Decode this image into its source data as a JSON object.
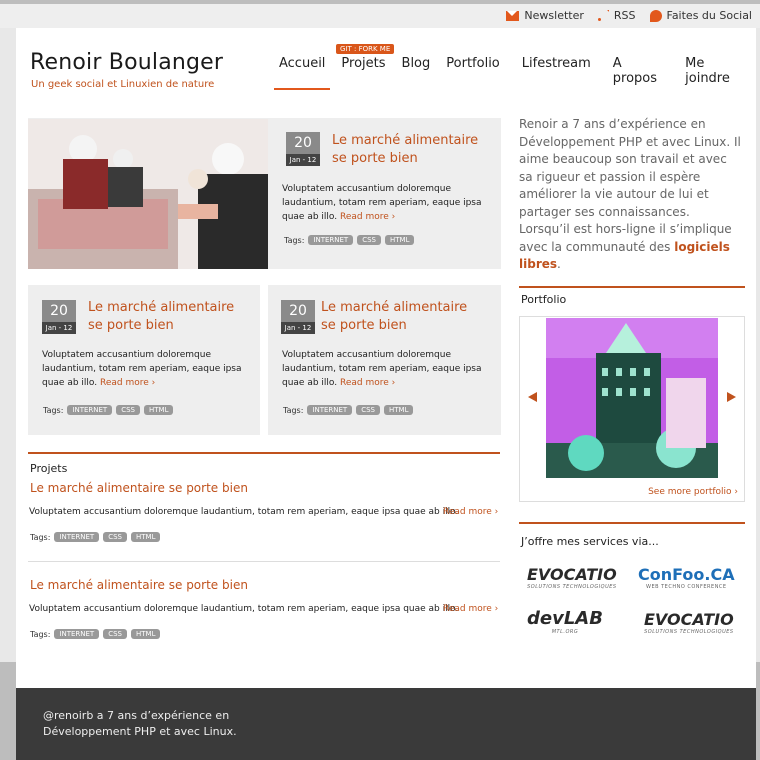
{
  "topbar": {
    "newsletter": "Newsletter",
    "rss": "RSS",
    "social": "Faites du Social"
  },
  "header": {
    "logo": "Renoir Boulanger",
    "tagline": "Un geek social et Linuxien de nature",
    "git_badge": "GIT : FORK ME",
    "nav": [
      "Accueil",
      "Projets",
      "Blog",
      "Portfolio",
      "Lifestream",
      "A propos",
      "Me joindre"
    ]
  },
  "featured": {
    "day": "20",
    "month": "Jan - 12",
    "title": "Le marché alimentaire se porte bien",
    "excerpt": "Voluptatem accusantium doloremque laudantium, totam rem aperiam, eaque ipsa quae ab illo.",
    "more": "Read more ›",
    "tags_label": "Tags:",
    "tags": [
      "INTERNET",
      "CSS",
      "HTML"
    ]
  },
  "cards": [
    {
      "day": "20",
      "month": "Jan - 12",
      "title": "Le marché alimentaire se porte bien",
      "excerpt": "Voluptatem accusantium doloremque laudantium, totam rem aperiam, eaque ipsa quae ab illo.",
      "more": "Read more ›",
      "tags_label": "Tags:",
      "tags": [
        "INTERNET",
        "CSS",
        "HTML"
      ]
    },
    {
      "day": "20",
      "month": "Jan - 12",
      "title": "Le marché alimentaire se porte bien",
      "excerpt": "Voluptatem accusantium doloremque laudantium, totam rem aperiam, eaque ipsa quae ab illo.",
      "more": "Read more ›",
      "tags_label": "Tags:",
      "tags": [
        "INTERNET",
        "CSS",
        "HTML"
      ]
    }
  ],
  "projects": {
    "heading": "Projets",
    "items": [
      {
        "title": "Le marché alimentaire se porte bien",
        "excerpt": "Voluptatem accusantium doloremque laudantium, totam rem aperiam, eaque ipsa quae ab illo.",
        "more": "Read more ›",
        "tags_label": "Tags:",
        "tags": [
          "INTERNET",
          "CSS",
          "HTML"
        ]
      },
      {
        "title": "Le marché alimentaire se porte bien",
        "excerpt": "Voluptatem accusantium doloremque laudantium, totam rem aperiam, eaque ipsa quae ab illo.",
        "more": "Read more ›",
        "tags_label": "Tags:",
        "tags": [
          "INTERNET",
          "CSS",
          "HTML"
        ]
      }
    ]
  },
  "sidebar": {
    "bio_before": "Renoir a 7 ans d’expérience en Développement PHP et avec Linux. Il aime beaucoup son travail et avec sa rigueur et passion il espère améliorer la vie autour de lui et partager ses connaissances. Lorsqu’il est hors-ligne il s’implique avec la communauté des ",
    "bio_link": "logiciels libres",
    "bio_after": ".",
    "portfolio_heading": "Portfolio",
    "portfolio_more": "See more portfolio ›",
    "services_heading": "J’offre mes services via...",
    "partners": [
      {
        "name": "EVOCATIO",
        "sub": "SOLUTIONS TECHNOLOGIQUES"
      },
      {
        "name": "ConFoo.CA",
        "sub": "WEB TECHNO CONFERENCE"
      },
      {
        "name": "devLAB",
        "sub": "MTL.ORG"
      },
      {
        "name": "EVOCATIO",
        "sub": "SOLUTIONS TECHNOLOGIQUES"
      }
    ]
  },
  "footer": {
    "text": "@renoirb a 7 ans d’expérience en Développement PHP et avec Linux."
  },
  "colors": {
    "accent": "#c0521d",
    "card_bg": "#eeeeee",
    "footer_bg": "#3a3a3a"
  }
}
